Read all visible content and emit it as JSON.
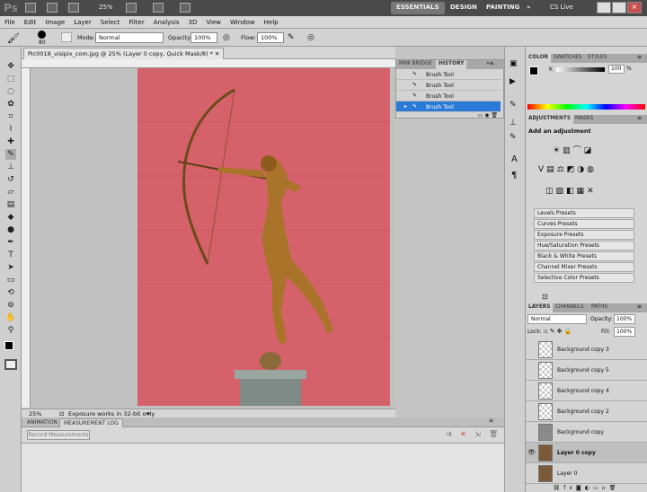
{
  "app": {
    "logo": "Ps",
    "zoom": "25%",
    "workspaces": [
      "ESSENTIALS",
      "DESIGN",
      "PAINTING"
    ],
    "cslive": "CS Live"
  },
  "menu": [
    "File",
    "Edit",
    "Image",
    "Layer",
    "Select",
    "Filter",
    "Analysis",
    "3D",
    "View",
    "Window",
    "Help"
  ],
  "options": {
    "brush_size": "80",
    "mode_label": "Mode:",
    "mode_value": "Normal",
    "opacity_label": "Opacity:",
    "opacity_value": "100%",
    "flow_label": "Flow:",
    "flow_value": "100%"
  },
  "document": {
    "tab_title": "Pic0018_visipix_com.jpg @ 25% (Layer 0 copy, Quick Mask/8) *",
    "status_zoom": "25%",
    "status_text": "Exposure works in 32-bit only"
  },
  "history": {
    "tabs": [
      "MINI BRIDGE",
      "HISTORY"
    ],
    "items": [
      "Brush Tool",
      "Brush Tool",
      "Brush Tool",
      "Brush Tool"
    ],
    "selected_index": 3
  },
  "bottom": {
    "tabs": [
      "ANIMATION",
      "MEASUREMENT LOG"
    ],
    "record_button": "Record Measurements"
  },
  "color_panel": {
    "tabs": [
      "COLOR",
      "SWATCHES",
      "STYLES"
    ],
    "channel": "K",
    "value": "100",
    "unit": "%"
  },
  "adjustments": {
    "tabs": [
      "ADJUSTMENTS",
      "MASKS"
    ],
    "heading": "Add an adjustment",
    "presets": [
      "Levels Presets",
      "Curves Presets",
      "Exposure Presets",
      "Hue/Saturation Presets",
      "Black & White Presets",
      "Channel Mixer Presets",
      "Selective Color Presets"
    ]
  },
  "layers": {
    "tabs": [
      "LAYERS",
      "CHANNELS",
      "PATHS"
    ],
    "blend_mode": "Normal",
    "opacity_label": "Opacity:",
    "opacity_value": "100%",
    "lock_label": "Lock:",
    "fill_label": "Fill:",
    "fill_value": "100%",
    "items": [
      "Background copy 3",
      "Background copy 5",
      "Background copy 4",
      "Background copy 2",
      "Background copy",
      "Layer 0 copy",
      "Layer 0"
    ],
    "selected_index": 5
  },
  "colors": {
    "accent": "#2c7ad7",
    "canvas_red": "#d5616a",
    "bronze": "#a9742a"
  }
}
